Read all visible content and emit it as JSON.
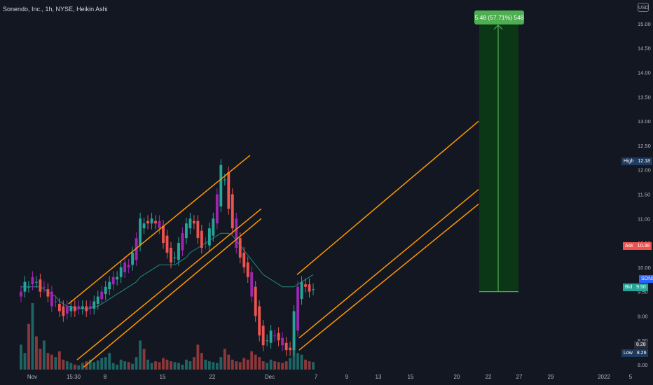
{
  "header": {
    "title": "Sonendo, Inc., 1h, NYSE, Heikin Ashi",
    "currency": "USD"
  },
  "colors": {
    "up": "#26a69a",
    "down": "#ef5350",
    "purple": "#9c27b0",
    "channel": "#ff9800",
    "ma": "#26a69a",
    "target_fill": "#0a3d14",
    "target_line": "#4caf50",
    "ask": "#ef5350",
    "bid": "#26a69a",
    "high": "#1e3a5f",
    "low": "#1e3a5f",
    "symbol": "#2962ff"
  },
  "price_axis": {
    "min": 7.9,
    "max": 15.2,
    "ticks": [
      "15.00",
      "14.50",
      "14.00",
      "13.50",
      "13.00",
      "12.50",
      "12.00",
      "11.50",
      "11.00",
      "10.50",
      "10.00",
      "9.50",
      "9.00",
      "8.50",
      "8.00"
    ]
  },
  "time_axis": {
    "ticks": [
      "Nov",
      "15:30",
      "8",
      "15",
      "22",
      "Dec",
      "7",
      "9",
      "13",
      "15",
      "20",
      "22",
      "27",
      "29",
      "2022",
      "5"
    ]
  },
  "price_labels": {
    "high": {
      "key": "High",
      "value": "12.18"
    },
    "ask": {
      "key": "Ask",
      "value": "10.38"
    },
    "symbol": {
      "key": "SONX"
    },
    "bid": {
      "key": "Bid",
      "value": "9.50"
    },
    "last": {
      "value": "8.28"
    },
    "low": {
      "key": "Low",
      "value": "8.26"
    }
  },
  "target": {
    "label": "5.48 (57.71%) 548",
    "from_price": 9.5,
    "to_price": 15.0
  },
  "chart_data": {
    "type": "candlestick",
    "title": "Sonendo, Inc., 1h, NYSE, Heikin Ashi",
    "ylim": [
      7.9,
      15.2
    ],
    "series": [
      {
        "name": "",
        "kind": "candles",
        "close": [
          9.5,
          9.7,
          9.6,
          9.8,
          9.7,
          9.5,
          9.6,
          9.4,
          9.2,
          9.3,
          9.1,
          9.0,
          9.2,
          9.2,
          9.1,
          9.2,
          9.2,
          9.1,
          9.2,
          9.3,
          9.4,
          9.5,
          9.6,
          9.7,
          9.8,
          9.8,
          10.0,
          10.1,
          10.0,
          10.3,
          10.6,
          11.0,
          10.9,
          10.9,
          11.0,
          10.9,
          10.8,
          10.5,
          10.3,
          10.1,
          10.2,
          10.5,
          10.7,
          10.9,
          11.0,
          10.9,
          10.6,
          10.4,
          10.5,
          10.8,
          11.0,
          11.5,
          12.1,
          11.8,
          11.2,
          10.8,
          10.4,
          10.2,
          10.0,
          9.8,
          9.4,
          9.0,
          8.6,
          8.4,
          8.5,
          8.7,
          8.6,
          8.5,
          8.4,
          8.3,
          8.3,
          9.1,
          9.6,
          9.7,
          9.6,
          9.5,
          9.55
        ]
      },
      {
        "name": "",
        "kind": "moving-average",
        "values": [
          9.6,
          9.6,
          9.6,
          9.6,
          9.6,
          9.6,
          9.55,
          9.5,
          9.45,
          9.4,
          9.3,
          9.25,
          9.2,
          9.2,
          9.15,
          9.15,
          9.15,
          9.15,
          9.15,
          9.2,
          9.2,
          9.25,
          9.3,
          9.35,
          9.4,
          9.45,
          9.5,
          9.55,
          9.6,
          9.65,
          9.7,
          9.8,
          9.85,
          9.9,
          9.95,
          10.0,
          10.05,
          10.05,
          10.05,
          10.05,
          10.05,
          10.1,
          10.15,
          10.2,
          10.3,
          10.35,
          10.4,
          10.45,
          10.5,
          10.55,
          10.6,
          10.65,
          10.7,
          10.7,
          10.7,
          10.65,
          10.55,
          10.45,
          10.35,
          10.25,
          10.15,
          10.05,
          9.95,
          9.85,
          9.8,
          9.75,
          9.7,
          9.65,
          9.6,
          9.6,
          9.6,
          9.6,
          9.65,
          9.7,
          9.75,
          9.8,
          9.85
        ]
      },
      {
        "name": "",
        "kind": "volume",
        "values": [
          30,
          20,
          55,
          80,
          40,
          25,
          35,
          20,
          18,
          15,
          22,
          12,
          10,
          8,
          6,
          5,
          8,
          10,
          12,
          9,
          11,
          14,
          15,
          20,
          8,
          6,
          12,
          10,
          9,
          7,
          15,
          35,
          25,
          12,
          8,
          10,
          9,
          14,
          12,
          10,
          9,
          8,
          6,
          12,
          10,
          15,
          30,
          20,
          12,
          10,
          9,
          8,
          15,
          25,
          18,
          12,
          10,
          9,
          14,
          12,
          22,
          18,
          15,
          10,
          8,
          12,
          10,
          9,
          8,
          10,
          14,
          40,
          20,
          18,
          12,
          10,
          9
        ]
      }
    ],
    "channels_price": [
      {
        "x": [
          0.105,
          0.383
        ],
        "y": [
          9.25,
          12.3
        ]
      },
      {
        "x": [
          0.118,
          0.4
        ],
        "y": [
          8.1,
          11.2
        ]
      },
      {
        "x": [
          0.128,
          0.4
        ],
        "y": [
          7.95,
          11.0
        ]
      },
      {
        "x": [
          0.455,
          0.733
        ],
        "y": [
          9.85,
          13.0
        ]
      },
      {
        "x": [
          0.458,
          0.733
        ],
        "y": [
          8.55,
          11.6
        ]
      },
      {
        "x": [
          0.458,
          0.733
        ],
        "y": [
          8.3,
          11.3
        ]
      }
    ]
  }
}
